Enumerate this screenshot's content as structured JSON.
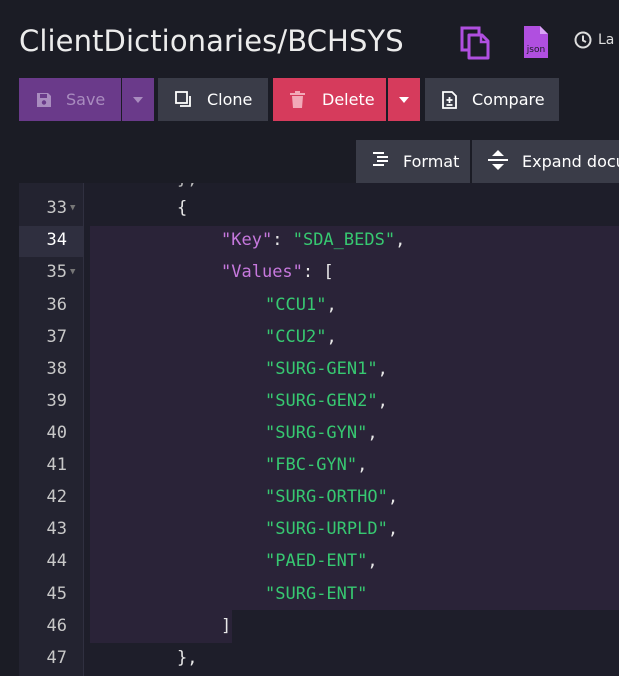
{
  "header": {
    "title": "ClientDictionaries/BCHSYS",
    "last_label": "La",
    "icons": [
      "copy-icon",
      "json-file-icon",
      "clock-icon"
    ],
    "json_icon_text": "json"
  },
  "toolbar": {
    "save_label": "Save",
    "clone_label": "Clone",
    "delete_label": "Delete",
    "compare_label": "Compare",
    "format_label": "Format",
    "expand_label": "Expand docu"
  },
  "colors": {
    "save": "#6a3a8a",
    "delete": "#d63b5c",
    "neutral_button": "#3a3c48",
    "key": "#c678dd",
    "string": "#37c871"
  },
  "editor": {
    "lines": [
      {
        "num": "33",
        "text": "{",
        "fold": true
      },
      {
        "num": "34",
        "key": "Key",
        "value": "SDA_BEDS",
        "active": true
      },
      {
        "num": "35",
        "key": "Values",
        "open": "[",
        "fold": true
      },
      {
        "num": "36",
        "str": "CCU1",
        "comma": ","
      },
      {
        "num": "37",
        "str": "CCU2",
        "comma": ","
      },
      {
        "num": "38",
        "str": "SURG-GEN1",
        "comma": ","
      },
      {
        "num": "39",
        "str": "SURG-GEN2",
        "comma": ","
      },
      {
        "num": "40",
        "str": "SURG-GYN",
        "comma": ","
      },
      {
        "num": "41",
        "str": "FBC-GYN",
        "comma": ","
      },
      {
        "num": "42",
        "str": "SURG-ORTHO",
        "comma": ","
      },
      {
        "num": "43",
        "str": "SURG-URPLD",
        "comma": ","
      },
      {
        "num": "44",
        "str": "PAED-ENT",
        "comma": ","
      },
      {
        "num": "45",
        "str": "SURG-ENT",
        "comma": ""
      },
      {
        "num": "46",
        "text": "]"
      },
      {
        "num": "47",
        "text": "},"
      }
    ]
  }
}
